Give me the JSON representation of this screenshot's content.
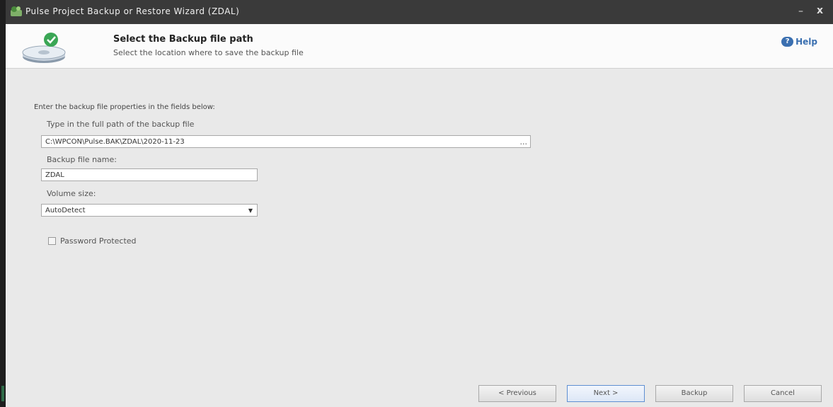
{
  "window": {
    "title": "Pulse Project Backup or Restore Wizard (ZDAL)",
    "minimize_label": "–",
    "close_label": "x"
  },
  "header": {
    "title": "Select the Backup file path",
    "subtitle": "Select the location where to save the backup file",
    "help_label": "Help"
  },
  "form": {
    "instructions": "Enter the backup file properties in the fields below:",
    "path_label": "Type in the full path of the backup file",
    "path_value": "C:\\WPCON\\Pulse.BAK\\ZDAL\\2020-11-23",
    "browse_label": "...",
    "name_label": "Backup file name:",
    "name_value": "ZDAL",
    "volume_label": "Volume size:",
    "volume_value": "AutoDetect",
    "password_label": "Password Protected"
  },
  "buttons": {
    "previous": "< Previous",
    "next": "Next >",
    "backup": "Backup",
    "cancel": "Cancel"
  },
  "colors": {
    "titlebar": "#3a3a3a",
    "body": "#e9e9e9",
    "help_accent": "#3a6fb0",
    "next_border": "#5f8fd2"
  }
}
